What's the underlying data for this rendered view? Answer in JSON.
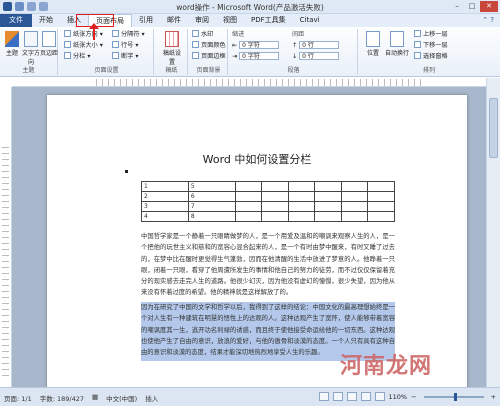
{
  "window": {
    "title": "word操作 - Microsoft Word(产品激活失败)"
  },
  "tabs": [
    "文件",
    "开始",
    "插入",
    "页面布局",
    "引用",
    "邮件",
    "审阅",
    "视图",
    "PDF工具集",
    "Citavi"
  ],
  "active_tab": "页面布局",
  "ribbon": {
    "theme_group": {
      "label": "主题",
      "buttons": [
        "主题",
        "文字方向",
        "页边距"
      ]
    },
    "page_setup_group": {
      "label": "页面设置",
      "items": [
        "纸张方向",
        "纸张大小",
        "分栏",
        "分隔符",
        "行号",
        "断字"
      ]
    },
    "draft_paper": {
      "label": "稿纸",
      "button": "稿纸设置"
    },
    "page_bg_group": {
      "label": "页面背景",
      "items": [
        "水印",
        "页面颜色",
        "页面边框"
      ]
    },
    "paragraph_group": {
      "label": "段落",
      "indent_label": "缩进",
      "spacing_label": "间距",
      "left_value": "0 字符",
      "right_value": "0 字符",
      "before_value": "0 行",
      "after_value": "0 行"
    },
    "arrange_group": {
      "label": "排列",
      "items": [
        "位置",
        "自动换行",
        "上移一层",
        "下移一层",
        "选择窗格"
      ]
    }
  },
  "document": {
    "title": "Word 中如何设置分栏",
    "table": [
      [
        "1",
        "5",
        "",
        "",
        "",
        "",
        "",
        ""
      ],
      [
        "2",
        "6",
        "",
        "",
        "",
        "",
        "",
        ""
      ],
      [
        "3",
        "7",
        "",
        "",
        "",
        "",
        "",
        ""
      ],
      [
        "4",
        "8",
        "",
        "",
        "",
        "",
        "",
        ""
      ]
    ],
    "paragraph1": "中国哲学家是一个静着一只眼睛做梦的人，是一个用爱及温和的嘲讽来观察人生的人，是一个把他的玩世主义和慈和的宽容心混合起来的人，是一个有时由梦中醒来，有时又睡了过去的，在梦中比在醒时更觉得生气蓬勃，因而在他清醒的生活中放进了梦意的人。他睁着一只眼，闭着一只眼，看穿了他周遭所发生的事情和他自己的努力的徒劳，而不过仅仅保留着充分的现实感去走完人生的道路。他很少幻灭，因为他没有虚幻的憧憬，很少失望，因为他从来没有怀着过度的希望。他的精神就是这样解放了的。",
    "paragraph2": "因为在研究了中国的文学和哲学以后，我得到了这样的结论：中国文化的最高理想始终是一个对人生有一种建筑在明慧的悟性上的达观的人。这种达观产生了宽怀，使人能够带着宽容的嘲讽度其一生，逃开功名利禄的诱惑，而且终于使他接受命运给他的一切东西。这种达观也使他产生了自由的意识，放浪的爱好，与他的傲骨和淡漠的态度。一个人只有具有这种自由的意识和淡漠的态度，结果才能深切地热烈地享受人生的乐趣。"
  },
  "statusbar": {
    "page": "页面: 1/1",
    "words": "字数: 189/427",
    "language": "中文(中国)",
    "mode": "插入",
    "zoom": "110%"
  },
  "watermark": "河南龙网",
  "colors": {
    "file_tab": "#2b5797",
    "highlight": "#b3c8ea",
    "annotation": "#e02020"
  }
}
